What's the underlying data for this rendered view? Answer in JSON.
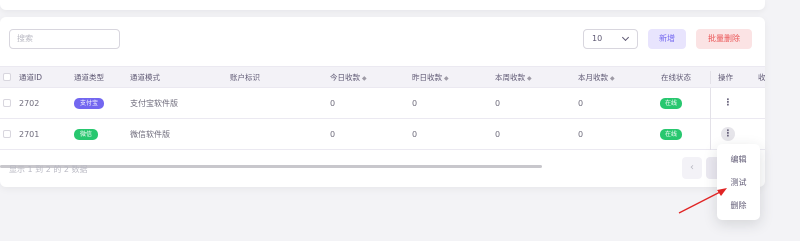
{
  "toolbar": {
    "search_placeholder": "搜索",
    "per_page": "10",
    "new_label": "新增",
    "batch_delete_label": "批量删除"
  },
  "table": {
    "headers": {
      "id": "通道ID",
      "type": "通道类型",
      "mode": "通道模式",
      "account": "账户标识",
      "today": "今日收款",
      "yesterday": "昨日收款",
      "week": "本周收款",
      "month": "本月收款",
      "status": "在线状态",
      "ops": "操作",
      "extra": "收"
    },
    "sort_glyph": "◆",
    "rows": [
      {
        "id": "2702",
        "type": "支付宝",
        "type_color": "#7367f0",
        "mode": "支付宝软件版",
        "today": "0",
        "yesterday": "0",
        "week": "0",
        "month": "0",
        "status": "在线"
      },
      {
        "id": "2701",
        "type": "微信",
        "type_color": "#28c76f",
        "mode": "微信软件版",
        "today": "0",
        "yesterday": "0",
        "week": "0",
        "month": "0",
        "status": "在线"
      }
    ],
    "kebab_glyph": "⋮"
  },
  "footer": {
    "summary": "显示 1 到 2 的 2 数据",
    "prev_glyph": "‹"
  },
  "row_menu": {
    "items": [
      "编辑",
      "测试",
      "删除"
    ]
  },
  "colors": {
    "primary": "#7367f0",
    "danger": "#ea5455",
    "success": "#28c76f",
    "annotation_arrow": "#e02424"
  }
}
